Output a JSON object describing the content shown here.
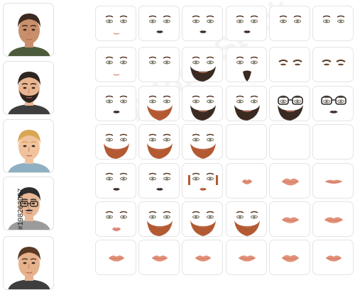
{
  "stock_id": "#198263057",
  "watermark_text": "Adobe Stock",
  "colors": {
    "skin": "#f2c9a4",
    "skin_shadow": "#e2ad86",
    "lip": "#e2927a",
    "lip_dark": "#c9725c",
    "brow": "#5a3a24",
    "iris": "#6a8a74",
    "beard_red": "#b35a33",
    "beard_dark": "#3b2a22",
    "glasses": "#2a2a2a"
  },
  "portraits": [
    {
      "name": "portrait-man-olive-shirt",
      "hair": "#3b2a22",
      "shirt": "#4c5b3a",
      "skin": "#c98f6b",
      "beard": "none",
      "glasses": false
    },
    {
      "name": "portrait-man-beard-dark-shirt",
      "hair": "#2e2420",
      "shirt": "#3e3e3e",
      "skin": "#e8b590",
      "beard": "#2e2420",
      "glasses": false
    },
    {
      "name": "portrait-man-blond",
      "hair": "#d9a653",
      "shirt": "#8fb0c2",
      "skin": "#f0c39e",
      "beard": "none",
      "glasses": false
    },
    {
      "name": "portrait-man-glasses-mustache",
      "hair": "#2d2d2d",
      "shirt": "#9b9b9b",
      "skin": "#e9b896",
      "beard": "mustache",
      "glasses": true
    },
    {
      "name": "portrait-man-brown-hair",
      "hair": "#5a3a24",
      "shirt": "#3e3e3e",
      "skin": "#e6b28c",
      "beard": "none",
      "glasses": false
    }
  ],
  "tile_rows": [
    [
      "eyes-neutral",
      "eyes-mustache",
      "eyes-thin-mustache",
      "eyes-small-mustache",
      "eyes-only",
      "eyes-only-b"
    ],
    [
      "eyes-plain",
      "beard-full-red",
      "beard-full-gray",
      "beard-goatee",
      "brows-only",
      "brows-only-b"
    ],
    [
      "eyes-mustache-small",
      "beard-red-round",
      "beard-dark-round",
      "beard-dark-full",
      "glasses-beard",
      "glasses-mustache"
    ],
    [
      "beard-red-long",
      "beard-red-long-b",
      "beard-red-light",
      "empty",
      "empty",
      "empty"
    ],
    [
      "eyes-mustache-c",
      "eyes-mustache-d",
      "eyes-sideburns",
      "lips-small",
      "lips-full",
      "lips-thin"
    ],
    [
      "eyes-lips",
      "beard-red-curly",
      "beard-red-full",
      "beard-red-goatee",
      "lips-medium",
      "lips-wide"
    ],
    [
      "lips-a",
      "lips-b",
      "lips-c",
      "lips-d",
      "lips-e",
      "lips-f"
    ]
  ]
}
